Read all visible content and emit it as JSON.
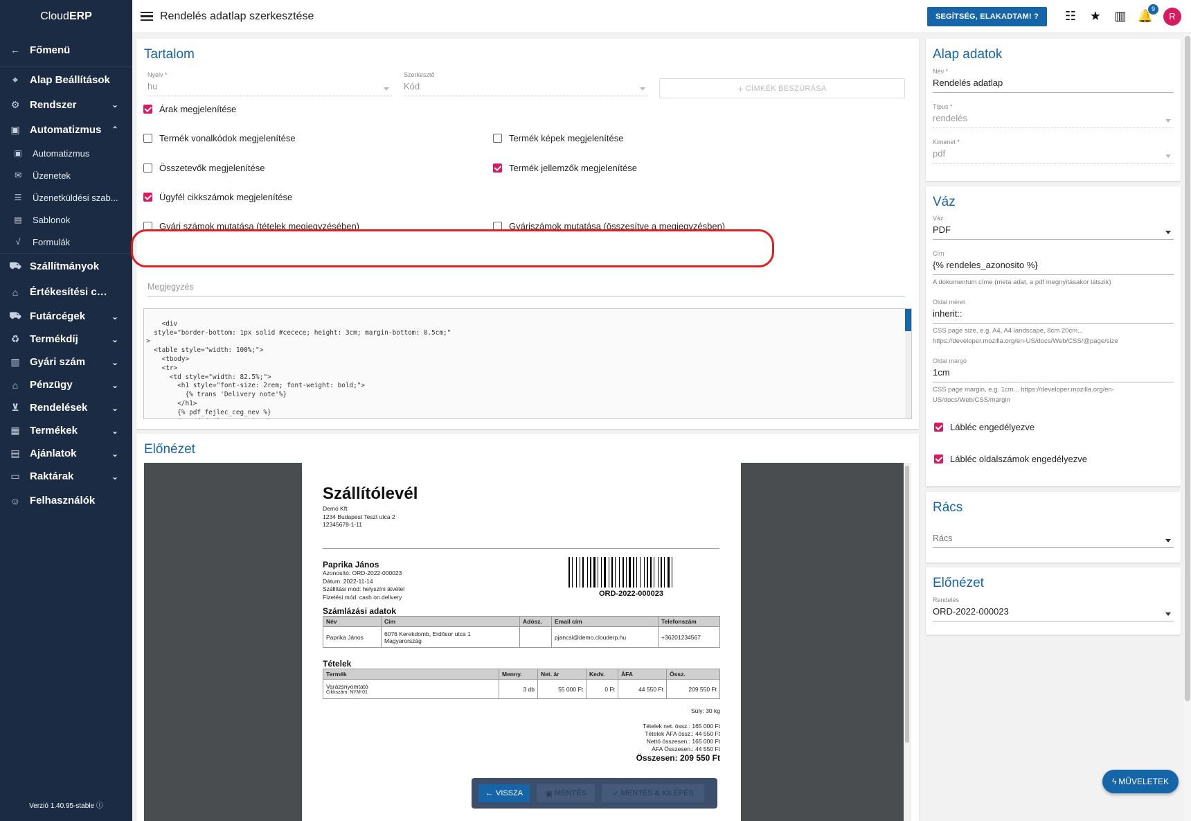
{
  "app": {
    "logo_plain": "Cloud",
    "logo_bold": "ERP",
    "version": "Verzió 1.40.95-stable"
  },
  "sidebar": {
    "back": {
      "label": "Főmenü",
      "icon": "arrow-left-icon"
    },
    "items": [
      {
        "label": "Alap Beállítások",
        "icon": "map-pin-icon",
        "chevron": ""
      },
      {
        "label": "Rendszer",
        "icon": "gears-icon",
        "chevron": "⌄"
      },
      {
        "label": "Automatizmus",
        "icon": "robot-icon",
        "chevron": "⌃"
      }
    ],
    "subitems": [
      {
        "label": "Automatizmus",
        "icon": "robot-icon"
      },
      {
        "label": "Üzenetek",
        "icon": "messages-icon"
      },
      {
        "label": "Üzenetküldési szab...",
        "icon": "sliders-icon"
      },
      {
        "label": "Sablonok",
        "icon": "file-icon"
      },
      {
        "label": "Formulák",
        "icon": "formula-icon"
      }
    ],
    "items2": [
      {
        "label": "Szállítmányok",
        "icon": "truck-icon",
        "chevron": ""
      },
      {
        "label": "Értékesítési csat...",
        "icon": "basket-icon",
        "chevron": ""
      },
      {
        "label": "Futárcégek",
        "icon": "courier-truck-icon",
        "chevron": "⌄"
      },
      {
        "label": "Termékdíj",
        "icon": "recycle-icon",
        "chevron": "⌄"
      },
      {
        "label": "Gyári szám",
        "icon": "barcode-icon",
        "chevron": "⌄"
      },
      {
        "label": "Pénzügy",
        "icon": "bank-icon",
        "chevron": "⌄"
      },
      {
        "label": "Rendelések",
        "icon": "cart-icon",
        "chevron": "⌄"
      },
      {
        "label": "Termékek",
        "icon": "boxes-icon",
        "chevron": "⌄"
      },
      {
        "label": "Ajánlatok",
        "icon": "offer-icon",
        "chevron": "⌄"
      },
      {
        "label": "Raktárak",
        "icon": "warehouse-icon",
        "chevron": "⌄"
      },
      {
        "label": "Felhasználók",
        "icon": "users-icon",
        "chevron": ""
      }
    ]
  },
  "topbar": {
    "title": "Rendelés adatlap szerkesztése",
    "help": "SEGÍTSÉG, ELAKADTAM!",
    "notification_count": "9",
    "avatar": "R"
  },
  "content": {
    "title": "Tartalom",
    "language_label": "Nyelv *",
    "language_value": "hu",
    "editor_label": "Szerkesztő",
    "editor_value": "Kód",
    "insert_tags": "CÍMKÉK BESZÚRÁSA",
    "checkboxes": [
      {
        "label": "Árak megjelenítése",
        "checked": true
      },
      {
        "label": "Termék vonalkódok megjelenítése",
        "checked": false
      },
      {
        "label": "Termék képek megjelenítése",
        "checked": false
      },
      {
        "label": "Összetevők megjelenítése",
        "checked": false
      },
      {
        "label": "Termék jellemzők megjelenítése",
        "checked": true
      },
      {
        "label": "Ügyfél cikkszámok megjelenítése",
        "checked": true
      },
      {
        "label": "Gyári számok mutatása (tételek megjegyzésében)",
        "checked": false
      },
      {
        "label": "Gyáriszámok mutatása (összesítve a megjegyzésben)",
        "checked": false
      }
    ],
    "note_placeholder": "Megjegyzés",
    "code": "<div\n  style=\"border-bottom: 1px solid #cecece; height: 3cm; margin-bottom: 0.5cm;\"\n>\n  <table style=\"width: 100%;\">\n    <tbody>\n    <tr>\n      <td style=\"width: 82.5%;\">\n        <h1 style=\"font-size: 2rem; font-weight: bold;\">\n          {% trans 'Delivery note'%}\n        </h1>\n        {% pdf_fejlec_ceg_nev %}\n        {% pdf_fejlec_ceg_cim %}"
  },
  "preview": {
    "title": "Előnézet",
    "doc_title": "Szállítólevél",
    "company": [
      "Demó Kft",
      "1234 Budapest Teszt utca 2",
      "12345678-1-11"
    ],
    "customer_name": "Paprika János",
    "customer_lines": [
      "Azonosító: ORD-2022-000023",
      "Dátum: 2022-11-14",
      "Szállítási mód: helyszíni átvétel",
      "Fizetési mód: cash on delivery"
    ],
    "barcode_text": "ORD-2022-000023",
    "billing_title": "Számlázási adatok",
    "billing_headers": [
      "Név",
      "Cím",
      "Adósz.",
      "Email cím",
      "Telefonszám"
    ],
    "billing_row": [
      "Paprika János",
      "6076 Kerekdomb, Erdősor utca 1",
      "Magyarország",
      "",
      "pjancsi@demo.clouderp.hu",
      "+36201234567"
    ],
    "items_title": "Tételek",
    "items_headers": [
      "Termék",
      "Menny.",
      "Net. ár",
      "Kedv.",
      "ÁFA",
      "Össz."
    ],
    "item": {
      "name": "Varázsnyomtató",
      "sku": "Cikkszám: NYM-01",
      "qty": "3 db",
      "net": "55 000 Ft",
      "disc": "0 Ft",
      "vat": "44 550 Ft",
      "total": "209 550 Ft"
    },
    "weight": "Súly: 30 kg",
    "sums": [
      "Tételek net. össz.: 165 000 Ft",
      "Tételek ÁFA össz.: 44 550 Ft",
      "Nettó összesen.: 165 000 Ft",
      "ÁFA Összesen.: 44 550 Ft"
    ],
    "total": "Összesen: 209 550 Ft",
    "back_btn": "VISSZA",
    "save_btn": "MENTÉS",
    "save_exit_btn": "MENTÉS & KILÉPÉS"
  },
  "basic": {
    "title": "Alap adatok",
    "name_label": "Név *",
    "name_value": "Rendelés adatlap",
    "type_label": "Típus *",
    "type_value": "rendelés",
    "output_label": "Kimenet *",
    "output_value": "pdf"
  },
  "vaz": {
    "title": "Váz",
    "vaz_label": "Váz",
    "vaz_value": "PDF",
    "cim_label": "Cím",
    "cim_value": "{% rendeles_azonosito %}",
    "cim_hint": "A dokumentum címe (meta adat, a pdf megnyitásakor látszik)",
    "size_label": "Oldal méret",
    "size_value": "inherit::",
    "size_hint1": "CSS page size, e.g. A4, A4 landscape, 8cm 20cm...",
    "size_hint2": "https://developer.mozilla.org/en-US/docs/Web/CSS/@page/size",
    "margin_label": "Oldal margó",
    "margin_value": "1cm",
    "margin_hint1": "CSS page margin, e.g. 1cm... https://developer.mozilla.org/en-",
    "margin_hint2": "US/docs/Web/CSS/margin",
    "footer_enabled": "Lábléc engedélyezve",
    "footer_pages": "Lábléc oldalszámok engedélyezve"
  },
  "racs": {
    "title": "Rács",
    "placeholder": "Rács"
  },
  "right_preview": {
    "title": "Előnézet",
    "order_label": "Rendelés",
    "order_value": "ORD-2022-000023"
  },
  "fab": "MŰVELETEK"
}
